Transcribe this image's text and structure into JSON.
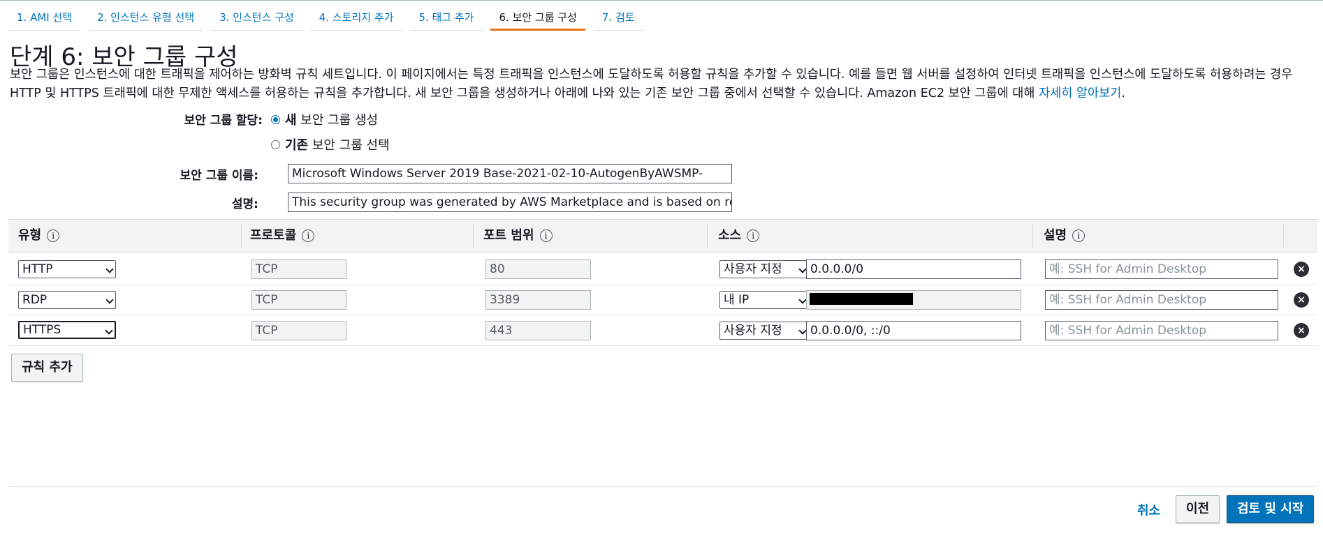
{
  "tabs": [
    {
      "label": "1. AMI 선택"
    },
    {
      "label": "2. 인스턴스 유형 선택"
    },
    {
      "label": "3. 인스턴스 구성"
    },
    {
      "label": "4. 스토리지 추가"
    },
    {
      "label": "5. 태그 추가"
    },
    {
      "label": "6. 보안 그룹 구성"
    },
    {
      "label": "7. 검토"
    }
  ],
  "page_title": "단계 6: 보안 그룹 구성",
  "intro": {
    "text": "보안 그룹은 인스턴스에 대한 트래픽을 제어하는 방화벽 규칙 세트입니다. 이 페이지에서는 특정 트래픽을 인스턴스에 도달하도록 허용할 규칙을 추가할 수 있습니다. 예를 들면 웹 서버를 설정하여 인터넷 트래픽을 인스턴스에 도달하도록 허용하려는 경우 HTTP 및 HTTPS 트래픽에 대한 무제한 액세스를 허용하는 규칙을 추가합니다. 새 보안 그룹을 생성하거나 아래에 나와 있는 기존 보안 그룹 중에서 선택할 수 있습니다. Amazon EC2 보안 그룹에 대해 ",
    "link": "자세히 알아보기",
    "end": "."
  },
  "assign": {
    "label": "보안 그룹 할당:",
    "new_bold": "새",
    "new_rest": " 보안 그룹 생성",
    "existing_bold": "기존",
    "existing_rest": " 보안 그룹 선택"
  },
  "sg_name": {
    "label": "보안 그룹 이름:",
    "value": "Microsoft Windows Server 2019 Base-2021-02-10-AutogenByAWSMP-"
  },
  "sg_desc": {
    "label": "설명:",
    "value": "This security group was generated by AWS Marketplace and is based on recomm"
  },
  "table": {
    "headers": [
      "유형",
      "프로토콜",
      "포트 범위",
      "소스",
      "설명"
    ],
    "info_glyph": "i",
    "remove_glyph": "×",
    "placeholder": "예: SSH for Admin Desktop",
    "rows": [
      {
        "type": "HTTP",
        "protocol": "TCP",
        "port": "80",
        "source_type": "사용자 지정",
        "source": "0.0.0.0/0"
      },
      {
        "type": "RDP",
        "protocol": "TCP",
        "port": "3389",
        "source_type": "내 IP",
        "source": ""
      },
      {
        "type": "HTTPS",
        "protocol": "TCP",
        "port": "443",
        "source_type": "사용자 지정",
        "source": "0.0.0.0/0, ::/0"
      }
    ]
  },
  "add_rule": "규칙 추가",
  "footer": {
    "cancel": "취소",
    "previous": "이전",
    "review_launch": "검토 및 시작"
  },
  "colors": {
    "accent": "#ec7211",
    "link": "#0073bb",
    "primary_button": "#0073bb"
  }
}
